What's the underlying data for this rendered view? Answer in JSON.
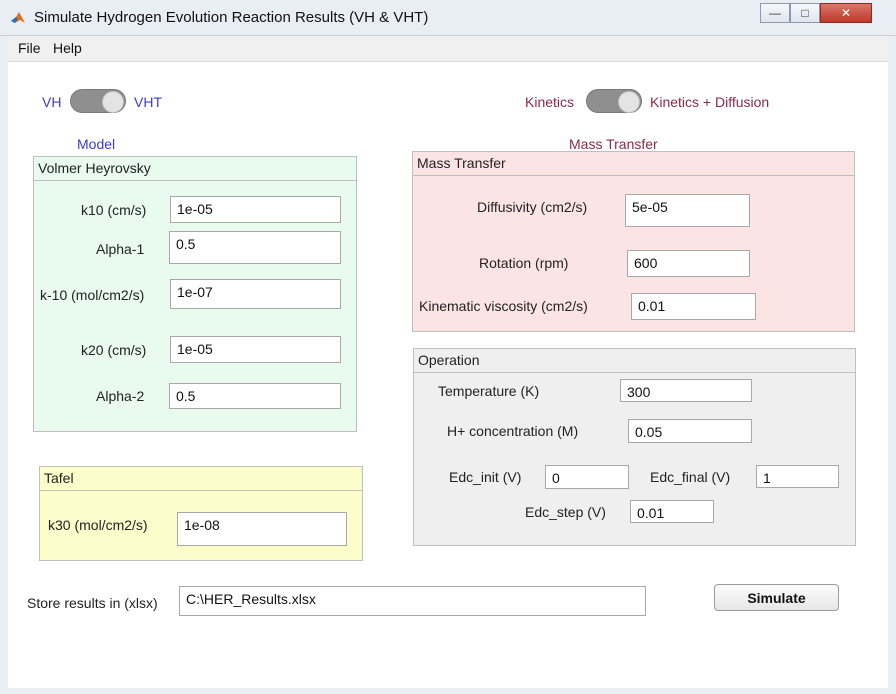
{
  "window": {
    "title": "Simulate Hydrogen Evolution Reaction Results (VH & VHT)"
  },
  "menu": [
    "File",
    "Help"
  ],
  "toggles": {
    "model": {
      "left": "VH",
      "right": "VHT"
    },
    "transport": {
      "left": "Kinetics",
      "right": "Kinetics + Diffusion"
    }
  },
  "colors": {
    "model_blue": "#3c3cc8",
    "transport_maroon": "#8c2a4a",
    "vh_panel": "#e8fbee",
    "tafel_panel": "#fdfdcc",
    "mass_panel": "#fde4e4",
    "op_panel": "#efefef"
  },
  "model": {
    "section_label": "Model",
    "vh_panel_title": "Volmer Heyrovsky",
    "fields": [
      {
        "label": "k10 (cm/s)",
        "value": "1e-05"
      },
      {
        "label": "Alpha-1",
        "value": "0.5"
      },
      {
        "label": "k-10 (mol/cm2/s)",
        "value": "1e-07"
      },
      {
        "label": "k20 (cm/s)",
        "value": "1e-05"
      },
      {
        "label": "Alpha-2",
        "value": "0.5"
      }
    ],
    "tafel_panel_title": "Tafel",
    "tafel_field": {
      "label": "k30 (mol/cm2/s)",
      "value": "1e-08"
    }
  },
  "mass_transfer": {
    "section_label": "Mass Transfer",
    "panel_title": "Mass Transfer",
    "fields": [
      {
        "label": "Diffusivity (cm2/s)",
        "value": "5e-05"
      },
      {
        "label": "Rotation (rpm)",
        "value": "600"
      },
      {
        "label": "Kinematic viscosity (cm2/s)",
        "value": "0.01"
      }
    ]
  },
  "operation": {
    "panel_title": "Operation",
    "temperature": {
      "label": "Temperature (K)",
      "value": "300"
    },
    "h_conc": {
      "label": "H+ concentration (M)",
      "value": "0.05"
    },
    "edc_init": {
      "label": "Edc_init (V)",
      "value": "0"
    },
    "edc_final": {
      "label": "Edc_final (V)",
      "value": "1"
    },
    "edc_step": {
      "label": "Edc_step (V)",
      "value": "0.01"
    }
  },
  "store": {
    "label": "Store results in (xlsx)",
    "value": "C:\\HER_Results.xlsx"
  },
  "simulate_label": "Simulate"
}
